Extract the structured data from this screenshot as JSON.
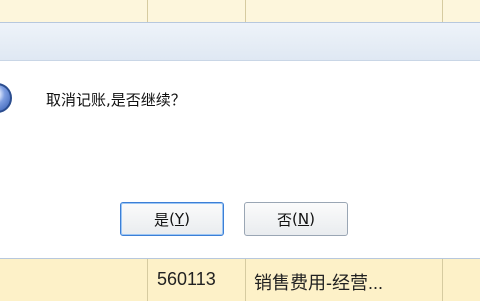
{
  "dialog": {
    "message": "取消记账,是否继续？",
    "icon": "question-icon",
    "buttons": {
      "yes": {
        "label": "是",
        "hotkey_open": "(",
        "hotkey": "Y",
        "hotkey_close": ")"
      },
      "no": {
        "label": "否",
        "hotkey_open": "(",
        "hotkey": "N",
        "hotkey_close": ")"
      }
    }
  },
  "spreadsheet": {
    "visible_row": {
      "account_code": "560113",
      "account_name": "销售费用-经营..."
    }
  },
  "colors": {
    "sheet_background": "#fdf6dc",
    "dialog_title_bar": "#e6edf6",
    "default_button_border": "#3c7fd6"
  }
}
